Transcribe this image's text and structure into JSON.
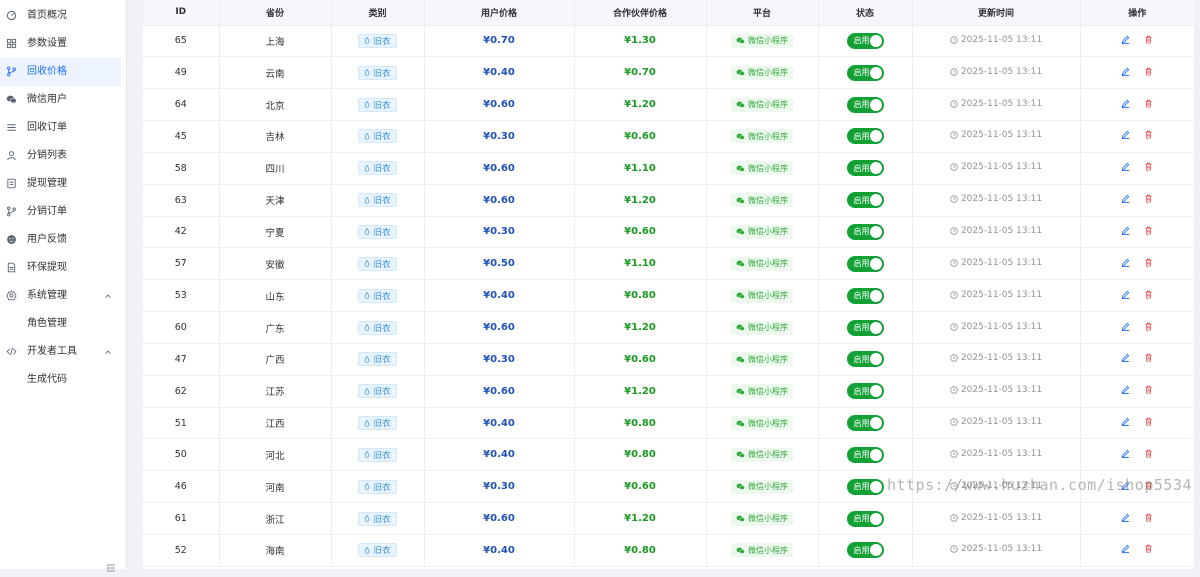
{
  "sidebar": {
    "items": [
      {
        "label": "首页概况",
        "icon": "dashboard-icon"
      },
      {
        "label": "参数设置",
        "icon": "grid-icon"
      },
      {
        "label": "回收价格",
        "icon": "branch-icon",
        "active": true
      },
      {
        "label": "微信用户",
        "icon": "wechat-icon"
      },
      {
        "label": "回收订单",
        "icon": "list-icon"
      },
      {
        "label": "分销列表",
        "icon": "user-icon"
      },
      {
        "label": "提现管理",
        "icon": "document-icon"
      },
      {
        "label": "分销订单",
        "icon": "branch-icon"
      },
      {
        "label": "用户反馈",
        "icon": "smile-icon"
      },
      {
        "label": "环保提现",
        "icon": "file-icon"
      },
      {
        "label": "系统管理",
        "icon": "gear-icon",
        "expanded": true
      },
      {
        "label": "角色管理",
        "icon": "",
        "sub": true
      },
      {
        "label": "开发者工具",
        "icon": "code-icon",
        "expanded": true
      },
      {
        "label": "生成代码",
        "icon": "",
        "sub": true
      }
    ]
  },
  "table": {
    "columns": [
      "ID",
      "省份",
      "类别",
      "用户价格",
      "合作伙伴价格",
      "平台",
      "状态",
      "更新时间",
      "操作"
    ],
    "rows": [
      {
        "id": "65",
        "province": "上海",
        "category": "旧衣",
        "user_price": "¥0.70",
        "partner_price": "¥1.30",
        "platform": "微信小程序",
        "status": "启用",
        "updated": "2025-11-05 13:11"
      },
      {
        "id": "49",
        "province": "云南",
        "category": "旧衣",
        "user_price": "¥0.40",
        "partner_price": "¥0.70",
        "platform": "微信小程序",
        "status": "启用",
        "updated": "2025-11-05 13:11"
      },
      {
        "id": "64",
        "province": "北京",
        "category": "旧衣",
        "user_price": "¥0.60",
        "partner_price": "¥1.20",
        "platform": "微信小程序",
        "status": "启用",
        "updated": "2025-11-05 13:11"
      },
      {
        "id": "45",
        "province": "吉林",
        "category": "旧衣",
        "user_price": "¥0.30",
        "partner_price": "¥0.60",
        "platform": "微信小程序",
        "status": "启用",
        "updated": "2025-11-05 13:11"
      },
      {
        "id": "58",
        "province": "四川",
        "category": "旧衣",
        "user_price": "¥0.60",
        "partner_price": "¥1.10",
        "platform": "微信小程序",
        "status": "启用",
        "updated": "2025-11-05 13:11"
      },
      {
        "id": "63",
        "province": "天津",
        "category": "旧衣",
        "user_price": "¥0.60",
        "partner_price": "¥1.20",
        "platform": "微信小程序",
        "status": "启用",
        "updated": "2025-11-05 13:11"
      },
      {
        "id": "42",
        "province": "宁夏",
        "category": "旧衣",
        "user_price": "¥0.30",
        "partner_price": "¥0.60",
        "platform": "微信小程序",
        "status": "启用",
        "updated": "2025-11-05 13:11"
      },
      {
        "id": "57",
        "province": "安徽",
        "category": "旧衣",
        "user_price": "¥0.50",
        "partner_price": "¥1.10",
        "platform": "微信小程序",
        "status": "启用",
        "updated": "2025-11-05 13:11"
      },
      {
        "id": "53",
        "province": "山东",
        "category": "旧衣",
        "user_price": "¥0.40",
        "partner_price": "¥0.80",
        "platform": "微信小程序",
        "status": "启用",
        "updated": "2025-11-05 13:11"
      },
      {
        "id": "60",
        "province": "广东",
        "category": "旧衣",
        "user_price": "¥0.60",
        "partner_price": "¥1.20",
        "platform": "微信小程序",
        "status": "启用",
        "updated": "2025-11-05 13:11"
      },
      {
        "id": "47",
        "province": "广西",
        "category": "旧衣",
        "user_price": "¥0.30",
        "partner_price": "¥0.60",
        "platform": "微信小程序",
        "status": "启用",
        "updated": "2025-11-05 13:11"
      },
      {
        "id": "62",
        "province": "江苏",
        "category": "旧衣",
        "user_price": "¥0.60",
        "partner_price": "¥1.20",
        "platform": "微信小程序",
        "status": "启用",
        "updated": "2025-11-05 13:11"
      },
      {
        "id": "51",
        "province": "江西",
        "category": "旧衣",
        "user_price": "¥0.40",
        "partner_price": "¥0.80",
        "platform": "微信小程序",
        "status": "启用",
        "updated": "2025-11-05 13:11"
      },
      {
        "id": "50",
        "province": "河北",
        "category": "旧衣",
        "user_price": "¥0.40",
        "partner_price": "¥0.80",
        "platform": "微信小程序",
        "status": "启用",
        "updated": "2025-11-05 13:11"
      },
      {
        "id": "46",
        "province": "河南",
        "category": "旧衣",
        "user_price": "¥0.30",
        "partner_price": "¥0.60",
        "platform": "微信小程序",
        "status": "启用",
        "updated": "2025-11-05 13:11"
      },
      {
        "id": "61",
        "province": "浙江",
        "category": "旧衣",
        "user_price": "¥0.60",
        "partner_price": "¥1.20",
        "platform": "微信小程序",
        "status": "启用",
        "updated": "2025-11-05 13:11"
      },
      {
        "id": "52",
        "province": "海南",
        "category": "旧衣",
        "user_price": "¥0.40",
        "partner_price": "¥0.80",
        "platform": "微信小程序",
        "status": "启用",
        "updated": "2025-11-05 13:11"
      }
    ]
  },
  "watermark": "https://www.huzhan.com/ishop5534",
  "colors": {
    "accent": "#1e6fff",
    "user_price": "#1f52b5",
    "partner_price": "#1a9a23",
    "switch_on": "#13a034",
    "delete": "#e04b4b"
  }
}
